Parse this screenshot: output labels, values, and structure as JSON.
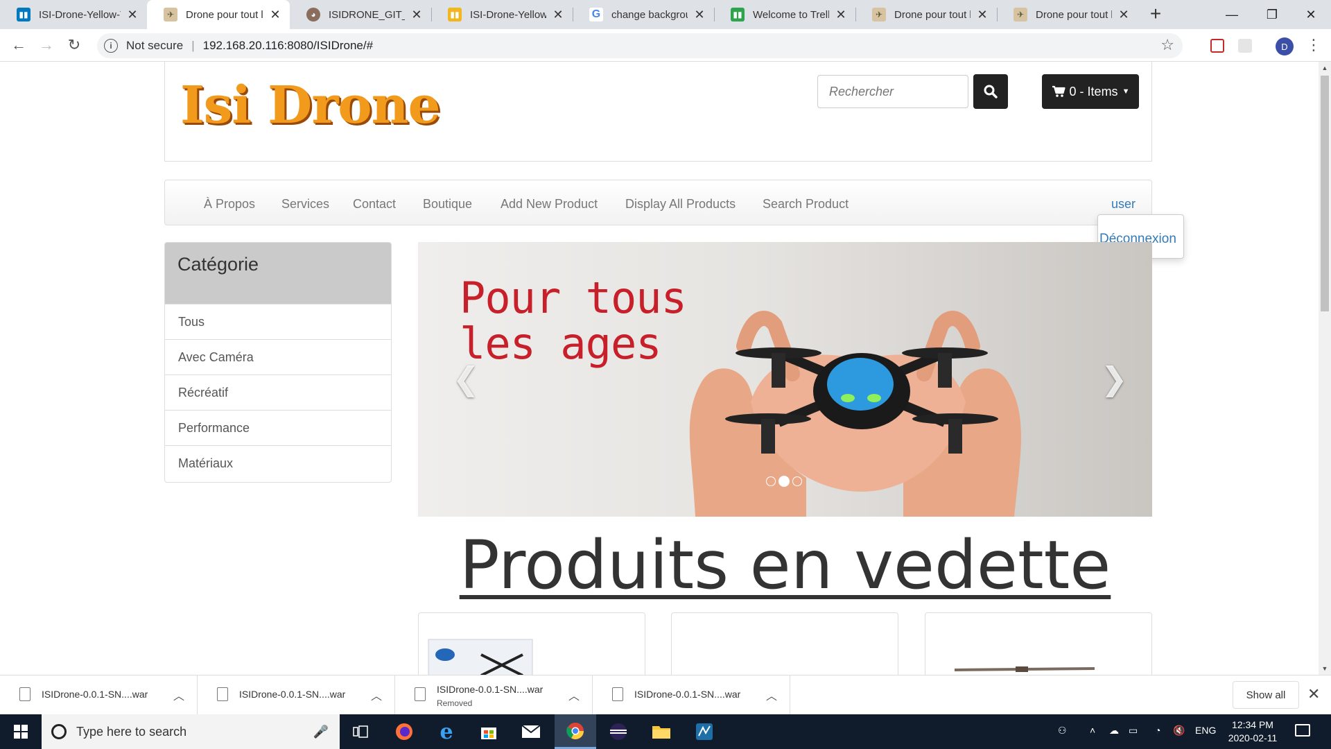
{
  "browser": {
    "tabs": [
      {
        "title": "ISI-Drone-Yellow-T",
        "icon": "trello-icon",
        "color": "#0079bf"
      },
      {
        "title": "Drone pour tout le",
        "icon": "drone-favicon",
        "color": "#b88a4a"
      },
      {
        "title": "ISIDRONE_GIT_YEL",
        "icon": "github-avatar-icon",
        "color": "#7a5a4a"
      },
      {
        "title": "ISI-Drone-Yellow |",
        "icon": "trello-yellow-icon",
        "color": "#f2b71f"
      },
      {
        "title": "change backgroun",
        "icon": "google-icon",
        "color": "#ffffff"
      },
      {
        "title": "Welcome to Trello!",
        "icon": "trello-icon",
        "color": "#2ea44f"
      },
      {
        "title": "Drone pour tout le",
        "icon": "drone-favicon",
        "color": "#b88a4a"
      },
      {
        "title": "Drone pour tout le",
        "icon": "drone-favicon",
        "color": "#b88a4a"
      }
    ],
    "security_label": "Not secure",
    "url": "192.168.20.116:8080/ISIDrone/#",
    "profile_initial": "D"
  },
  "site": {
    "logo": "Isi Drone",
    "search_placeholder": "Rechercher",
    "cart_label": "0 - Items",
    "nav": [
      "À Propos",
      "Services",
      "Contact",
      "Boutique",
      "Add New Product",
      "Display All Products",
      "Search Product"
    ],
    "user_label": "user",
    "logout_label": "Déconnexion",
    "category_title": "Catégorie",
    "categories": [
      "Tous",
      "Avec Caméra",
      "Récréatif",
      "Performance",
      "Matériaux"
    ],
    "carousel": {
      "line1": "Pour tous",
      "line2": "les ages",
      "active_slide": 2,
      "slide_count": 3
    },
    "featured_title": "Produits en vedette"
  },
  "downloads": {
    "items": [
      {
        "name": "ISIDrone-0.0.1-SN....war",
        "status": ""
      },
      {
        "name": "ISIDrone-0.0.1-SN....war",
        "status": ""
      },
      {
        "name": "ISIDrone-0.0.1-SN....war",
        "status": "Removed"
      },
      {
        "name": "ISIDrone-0.0.1-SN....war",
        "status": ""
      }
    ],
    "show_all": "Show all"
  },
  "taskbar": {
    "search_placeholder": "Type here to search",
    "language": "ENG",
    "time": "12:34 PM",
    "date": "2020-02-11"
  }
}
